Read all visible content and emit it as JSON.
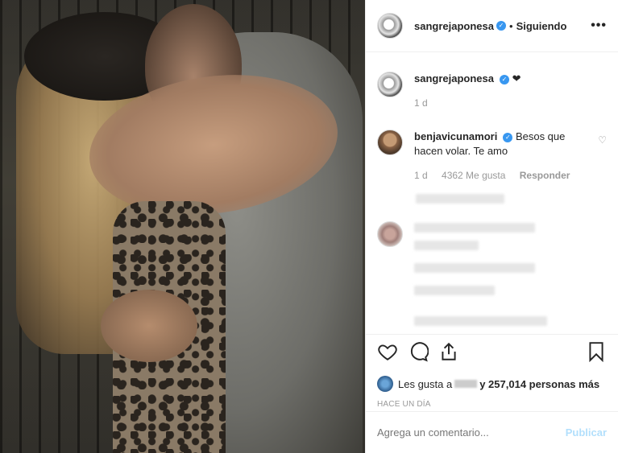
{
  "header": {
    "username": "sangrejaponesa",
    "separator": "•",
    "follow_label": "Siguiendo",
    "more_label": "•••",
    "verified_icon": "check-badge"
  },
  "caption": {
    "username": "sangrejaponesa",
    "text": "❤",
    "time": "1 d"
  },
  "comment": {
    "username": "benjavicunamori",
    "text": "Besos que hacen volar. Te amo",
    "time": "1 d",
    "likes": "4362 Me gusta",
    "reply_label": "Responder",
    "heart_icon": "♡"
  },
  "likes": {
    "prefix": "Les gusta a",
    "suffix": "y 257,014 personas más"
  },
  "timestamp": "HACE UN DÍA",
  "comment_input": {
    "placeholder": "Agrega un comentario...",
    "publish_label": "Publicar"
  },
  "colors": {
    "verified": "#3897f0",
    "publish_disabled": "#b2dffc",
    "text": "#262626",
    "muted": "#999999"
  }
}
